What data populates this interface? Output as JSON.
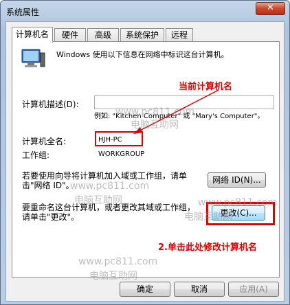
{
  "window": {
    "title": "系统属性",
    "close_glyph": "✕"
  },
  "tabs": [
    "计算机名",
    "硬件",
    "高级",
    "系统保护",
    "远程"
  ],
  "intro_text": "Windows 使用以下信息在网络中标识这台计算机。",
  "description": {
    "label": "计算机描述(D):",
    "value": "",
    "example": "例如: \"Kitchen Computer\" 或 \"Mary's Computer\"。"
  },
  "full_name": {
    "label": "计算机全名:",
    "value": "HJH-PC"
  },
  "workgroup": {
    "label": "工作组:",
    "value": "WORKGROUP"
  },
  "join_text": "若要使用向导将计算机加入域或工作组，请单击\"网络 ID\"。",
  "network_id_button": "网络 ID(N)...",
  "rename_text": "要重命名这台计算机，或者更改其域或工作组，请单击\"更改\"。",
  "change_button": "更改(C)...",
  "annotations": {
    "current_name": "当前计算机名",
    "click_here": "2.单击此处修改计算机名"
  },
  "watermark": {
    "url": "www.pc811.com",
    "site": "电脑互助网"
  },
  "footer": {
    "ok": "确定",
    "cancel": "取消",
    "apply": "应用(A)"
  },
  "colors": {
    "annotation_red": "#e00000",
    "title_bg": "#b9cde5"
  }
}
